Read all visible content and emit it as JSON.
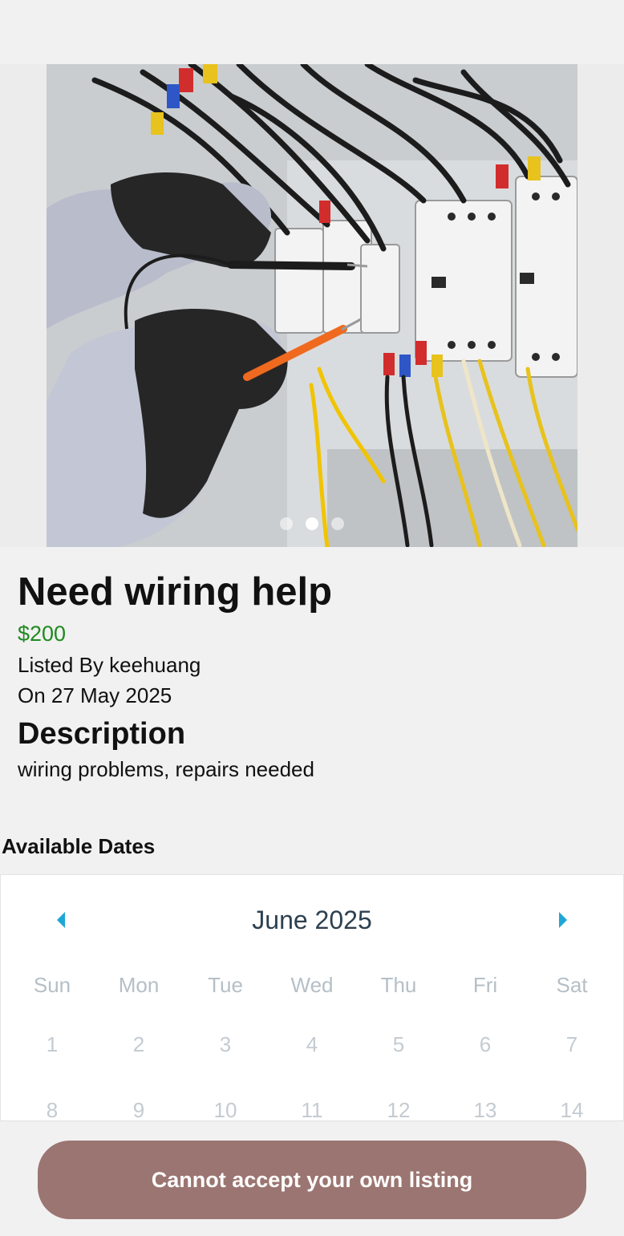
{
  "listing": {
    "title": "Need wiring help",
    "price": "$200",
    "listed_by": "Listed By keehuang",
    "date": "On 27 May 2025",
    "description_heading": "Description",
    "description": "wiring problems, repairs needed"
  },
  "carousel": {
    "image_subject": "electrician testing circuit breaker panel with multimeter probes",
    "slide_count": 3,
    "active_slide": 2
  },
  "availability": {
    "heading": "Available Dates",
    "month": "June 2025",
    "weekdays": [
      "Sun",
      "Mon",
      "Tue",
      "Wed",
      "Thu",
      "Fri",
      "Sat"
    ],
    "weeks": [
      [
        "1",
        "2",
        "3",
        "4",
        "5",
        "6",
        "7"
      ],
      [
        "8",
        "9",
        "10",
        "11",
        "12",
        "13",
        "14"
      ]
    ],
    "prev_icon": "caret-left-icon",
    "next_icon": "caret-right-icon",
    "accent_color": "#1ea7d6"
  },
  "action": {
    "label": "Cannot accept your own listing",
    "color": "#9b7571"
  }
}
